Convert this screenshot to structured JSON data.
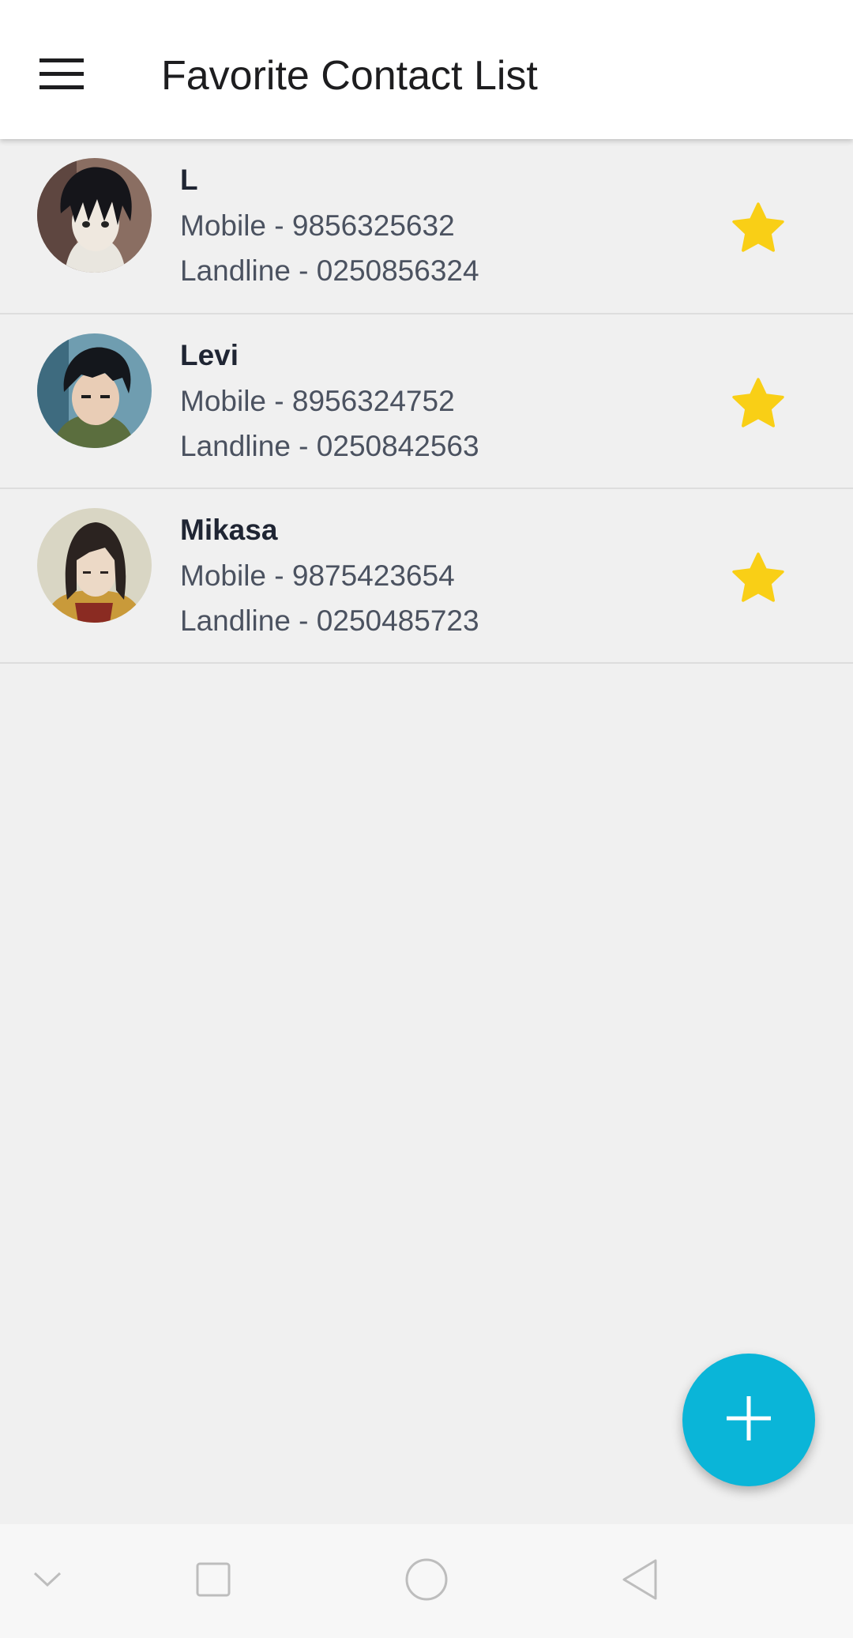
{
  "app_bar": {
    "title": "Favorite Contact List",
    "menu_icon": "hamburger-menu-icon"
  },
  "contacts": [
    {
      "name": "L",
      "mobile": "Mobile - 9856325632",
      "landline": "Landline - 0250856324",
      "favorite": true,
      "avatar_icon": "contact-avatar"
    },
    {
      "name": "Levi",
      "mobile": "Mobile - 8956324752",
      "landline": "Landline - 0250842563",
      "favorite": true,
      "avatar_icon": "contact-avatar"
    },
    {
      "name": "Mikasa",
      "mobile": "Mobile - 9875423654",
      "landline": "Landline - 0250485723",
      "favorite": true,
      "avatar_icon": "contact-avatar"
    }
  ],
  "fab": {
    "icon": "plus-icon",
    "color": "#0ab5d8"
  },
  "colors": {
    "star": "#f9cf16",
    "background": "#f0f0f0",
    "app_bar": "#ffffff"
  },
  "system_nav": {
    "icons": [
      "chevron-down-icon",
      "square-icon",
      "circle-icon",
      "back-triangle-icon"
    ]
  }
}
